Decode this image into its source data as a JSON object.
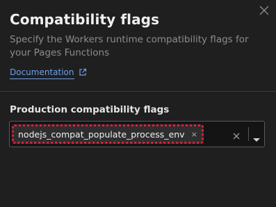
{
  "dialog": {
    "title": "Compatibility flags",
    "description": "Specify the Workers runtime compatibility flags for your Pages Functions",
    "documentation_link": "Documentation",
    "close_icon": "close-icon",
    "external_icon": "external-link-icon"
  },
  "production": {
    "label": "Production compatibility flags",
    "selected_flags": [
      "nodejs_compat_populate_process_env"
    ],
    "tag_remove_glyph": "×",
    "clear_icon": "clear-icon",
    "dropdown_icon": "chevron-down-icon"
  },
  "colors": {
    "background": "#1f1f1f",
    "link": "#6fa0ea",
    "highlight_outline": "#e0203a"
  }
}
